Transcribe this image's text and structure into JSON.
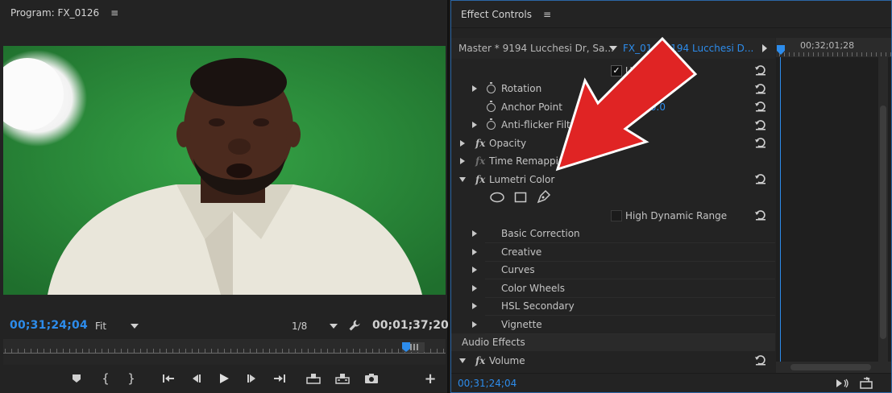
{
  "program": {
    "title": "Program: FX_0126",
    "current_timecode": "00;31;24;04",
    "fit_label": "Fit",
    "resolution_label": "1/8",
    "duration_timecode": "00;01;37;20"
  },
  "effect_controls": {
    "title": "Effect Controls",
    "master_clip": "Master * 9194 Lucchesi Dr, Sa...",
    "sequence_clip": "FX_01... 9194 Lucchesi D...",
    "timeline_timecode": "00;32;01;28",
    "footer_timecode": "00;31;24;04",
    "uniform_scale_label": "U",
    "rotation_label": "Rotation",
    "anchor_point_label": "Anchor Point",
    "anchor_point_value": "1080.0",
    "anchor_point_value_left": "0",
    "anti_flicker_label": "Anti-flicker Filter",
    "opacity_label": "Opacity",
    "time_remapping_label": "Time Remapping",
    "lumetri_label": "Lumetri Color",
    "hdr_label": "High Dynamic Range",
    "subsections": [
      "Basic Correction",
      "Creative",
      "Curves",
      "Color Wheels",
      "HSL Secondary",
      "Vignette"
    ],
    "audio_effects_label": "Audio Effects",
    "volume_label": "Volume"
  },
  "colors": {
    "timecode_blue": "#2d8ceb",
    "panel_bg": "#232323",
    "green_screen": "#2e8d3c",
    "arrow_red": "#e02424",
    "panel_focus_border": "#2b66a6"
  },
  "icons": {
    "transport": [
      "marker-icon",
      "mark-in-icon",
      "mark-out-icon",
      "go-to-in-icon",
      "step-back-icon",
      "play-icon",
      "step-forward-icon",
      "go-to-out-icon",
      "lift-icon",
      "extract-icon",
      "export-frame-icon",
      "add-button-icon"
    ]
  }
}
